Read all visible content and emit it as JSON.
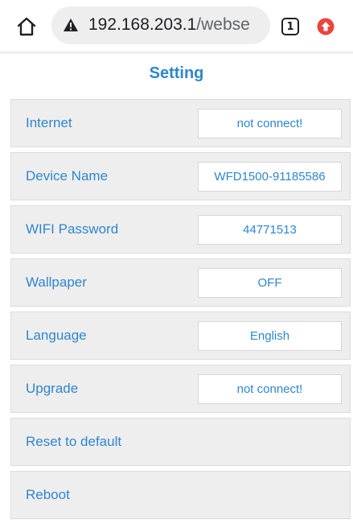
{
  "browser": {
    "url_host": "192.168.203.1",
    "url_path": "/webse",
    "tab_count": "1",
    "icons": {
      "home": "home-icon",
      "warning": "warning-triangle-icon",
      "tabs": "tab-switcher-icon",
      "update": "update-arrow-icon"
    },
    "update_color": "#e8453c"
  },
  "page": {
    "title": "Setting",
    "accent": "#2f86cf"
  },
  "settings": [
    {
      "label": "Internet",
      "value": "not connect!"
    },
    {
      "label": "Device Name",
      "value": "WFD1500-91185586"
    },
    {
      "label": "WIFI Password",
      "value": "44771513"
    },
    {
      "label": "Wallpaper",
      "value": "OFF"
    },
    {
      "label": "Language",
      "value": "English"
    },
    {
      "label": "Upgrade",
      "value": "not connect!"
    },
    {
      "label": "Reset to default"
    },
    {
      "label": "Reboot"
    }
  ]
}
